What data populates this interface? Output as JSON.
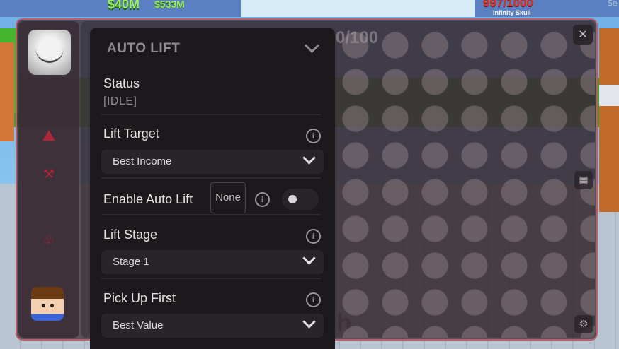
{
  "game": {
    "money_primary": "$40M",
    "money_secondary": "$533M",
    "health": "997/1000",
    "enemy_name": "Infinity Skull",
    "faint_counter": "0/100",
    "bottom_text": "rength"
  },
  "panel": {
    "title": "AUTO LIFT",
    "status_label": "Status",
    "status_value": "[IDLE]",
    "lift_target_label": "Lift Target",
    "lift_target_value": "Best Income",
    "enable_auto_lift_label": "Enable Auto Lift",
    "keybind_value": "None",
    "enable_auto_lift_on": false,
    "lift_stage_label": "Lift Stage",
    "lift_stage_value": "Stage 1",
    "pick_up_first_label": "Pick Up First",
    "pick_up_first_value": "Best Value"
  },
  "window": {
    "close_glyph": "✕"
  },
  "icons": {
    "info": "info-icon",
    "chevron": "chevron-down-icon",
    "grid": "grid-icon",
    "gear": "gear-icon"
  }
}
